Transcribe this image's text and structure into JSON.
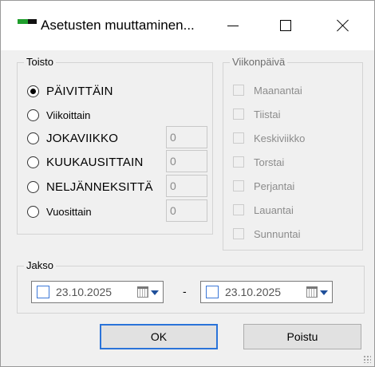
{
  "window": {
    "title": "Asetusten muuttaminen...",
    "controls": {
      "minimize": "minimize-icon",
      "maximize": "maximize-icon",
      "close": "close-icon"
    }
  },
  "toisto": {
    "title": "Toisto",
    "options": [
      {
        "label": "PÄIVITTÄIN",
        "checked": true,
        "has_input": false,
        "caps": true
      },
      {
        "label": "Viikoittain",
        "checked": false,
        "has_input": false,
        "caps": false
      },
      {
        "label": "JOKAVIIKKO",
        "checked": false,
        "has_input": true,
        "value": "0",
        "caps": true
      },
      {
        "label": "KUUKAUSITTAIN",
        "checked": false,
        "has_input": true,
        "value": "0",
        "caps": true
      },
      {
        "label": "NELJÄNNEKSITTÄ",
        "checked": false,
        "has_input": true,
        "value": "0",
        "caps": true
      },
      {
        "label": "Vuosittain",
        "checked": false,
        "has_input": true,
        "value": "0",
        "caps": false
      }
    ]
  },
  "viikonpaiva": {
    "title": "Viikonpäivä",
    "days": [
      "Maanantai",
      "Tiistai",
      "Keskiviikko",
      "Torstai",
      "Perjantai",
      "Lauantai",
      "Sunnuntai"
    ],
    "enabled": false
  },
  "jakso": {
    "title": "Jakso",
    "start_date": "23.10.2025",
    "separator": "-",
    "end_date": "23.10.2025"
  },
  "buttons": {
    "ok": "OK",
    "poistu": "Poistu"
  },
  "colors": {
    "accent": "#2a73d9",
    "icon_green": "#1f9e2c",
    "disabled_text": "#8c8c8c"
  }
}
